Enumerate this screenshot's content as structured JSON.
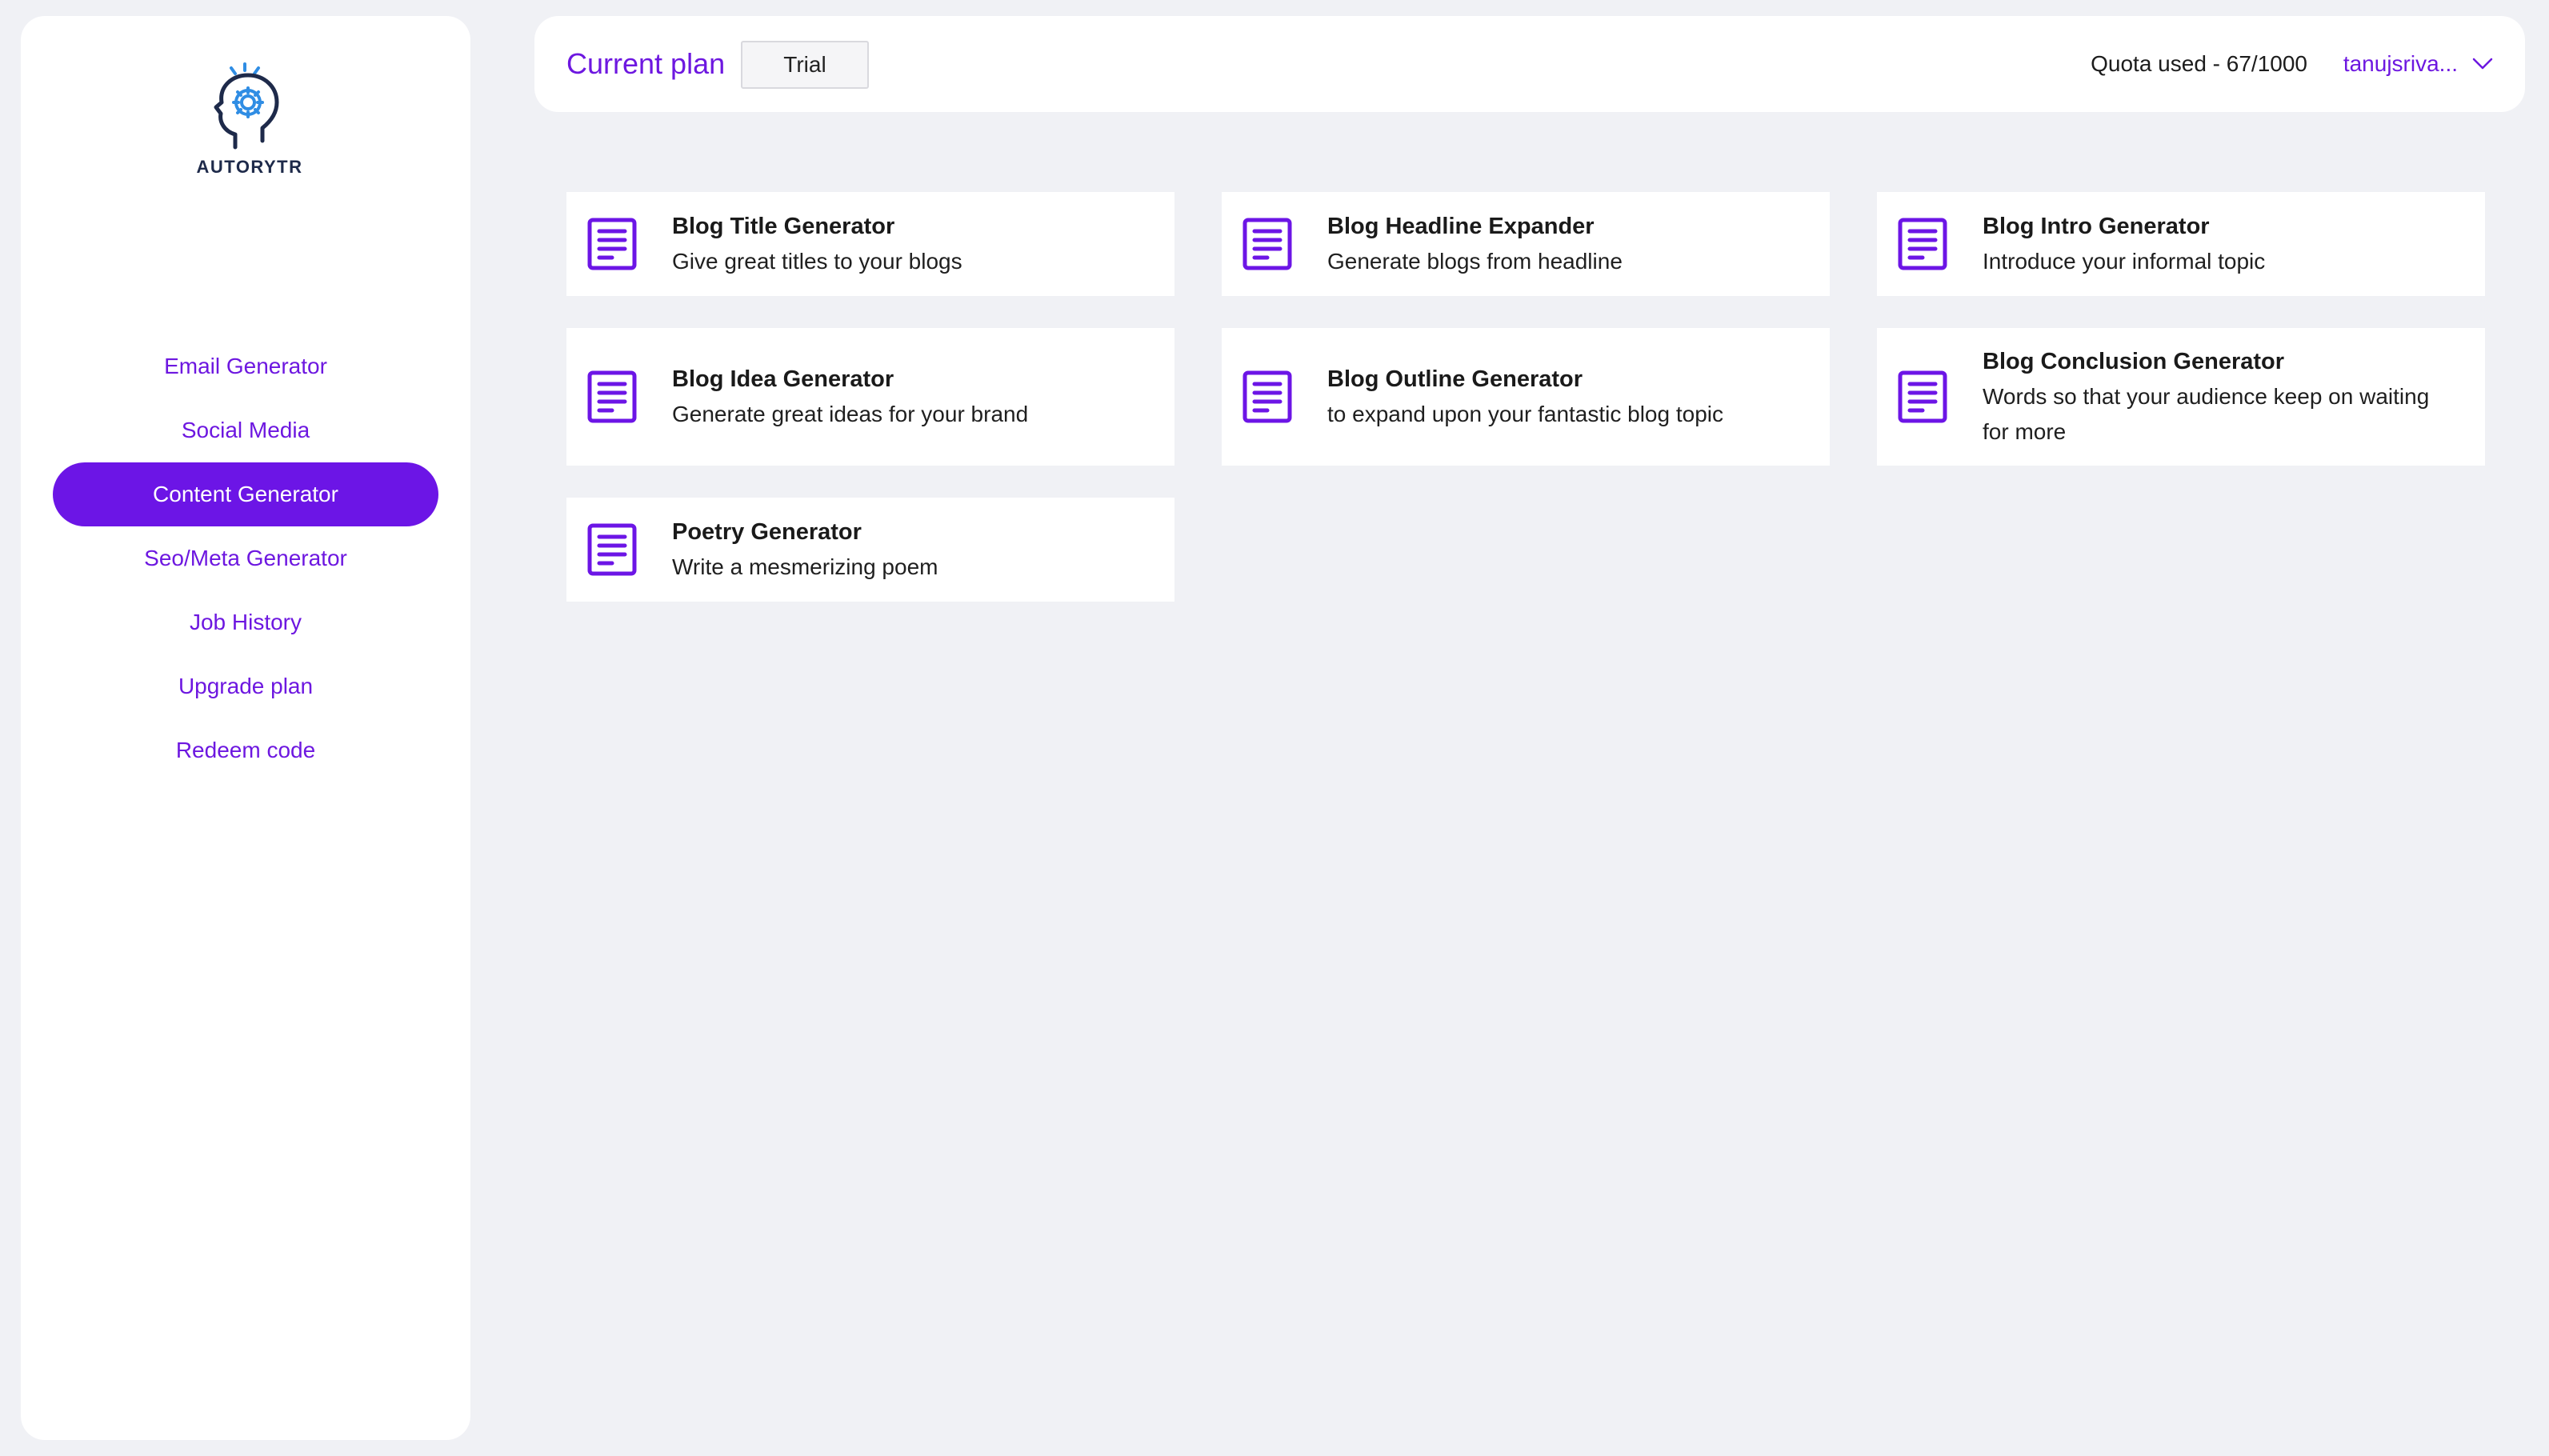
{
  "brand": {
    "name": "AUTORYTR",
    "color": "#6c15e6"
  },
  "sidebar": {
    "items": [
      {
        "label": "Email Generator",
        "active": false
      },
      {
        "label": "Social Media",
        "active": false
      },
      {
        "label": "Content Generator",
        "active": true
      },
      {
        "label": "Seo/Meta Generator",
        "active": false
      },
      {
        "label": "Job History",
        "active": false
      },
      {
        "label": "Upgrade plan",
        "active": false
      },
      {
        "label": "Redeem code",
        "active": false
      }
    ]
  },
  "header": {
    "plan_label": "Current plan",
    "plan_value": "Trial",
    "quota": "Quota used - 67/1000",
    "user": "tanujsriva..."
  },
  "tools": [
    {
      "title": "Blog Title Generator",
      "description": "Give great titles to your blogs",
      "icon": "document-icon"
    },
    {
      "title": "Blog Headline Expander",
      "description": "Generate blogs from headline",
      "icon": "document-icon"
    },
    {
      "title": "Blog Intro Generator",
      "description": "Introduce your informal topic",
      "icon": "document-icon"
    },
    {
      "title": "Blog Idea Generator",
      "description": "Generate great ideas for your brand",
      "icon": "document-icon"
    },
    {
      "title": "Blog Outline Generator",
      "description": "to expand upon your fantastic blog topic",
      "icon": "document-icon"
    },
    {
      "title": "Blog Conclusion Generator",
      "description": "Words so that your audience keep on waiting for more",
      "icon": "document-icon"
    },
    {
      "title": "Poetry Generator",
      "description": "Write a mesmerizing poem",
      "icon": "document-icon"
    }
  ]
}
